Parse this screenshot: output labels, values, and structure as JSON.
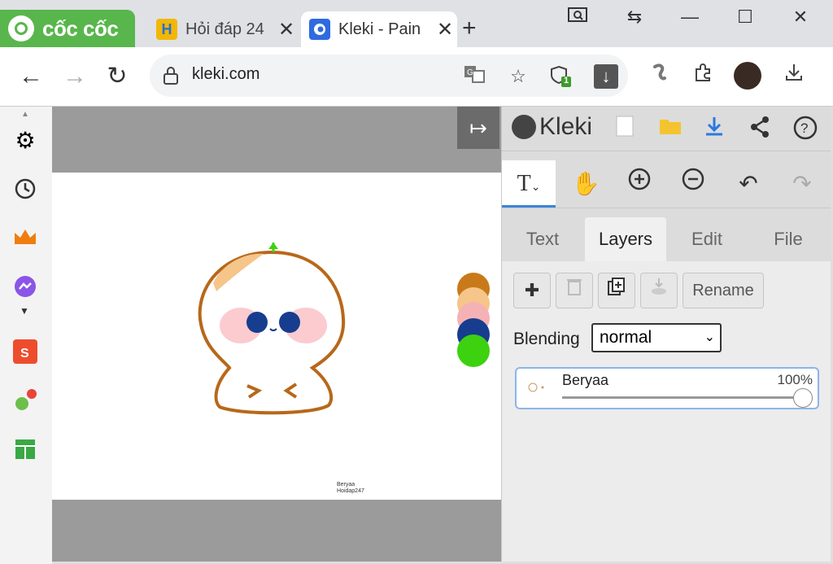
{
  "browser": {
    "brand": "cốc cốc",
    "tabs": [
      {
        "title": "Hỏi đáp 24",
        "favicon": "H"
      },
      {
        "title": "Kleki - Pain"
      }
    ],
    "new_tab": "+",
    "url": "kleki.com",
    "shield_badge": "1"
  },
  "kleki": {
    "logo": "Kleki",
    "tabs": [
      "Text",
      "Layers",
      "Edit",
      "File"
    ],
    "active_tab": "Layers",
    "tool_text_label": "T",
    "rename_label": "Rename",
    "blending_label": "Blending",
    "blending_value": "normal",
    "layers": [
      {
        "name": "Beryaa",
        "opacity": "100%",
        "opacity_value": 1.0
      }
    ]
  },
  "canvas": {
    "swatches": [
      "#c87a1a",
      "#f6c58a",
      "#f5b2b4",
      "#173d8f",
      "#3cd20f"
    ],
    "signature": [
      "Beryaa",
      "Hoidap247"
    ]
  },
  "colors": {
    "brand_green": "#58b64c",
    "accent_blue": "#3a86d6",
    "outline_brown": "#b7681a"
  }
}
